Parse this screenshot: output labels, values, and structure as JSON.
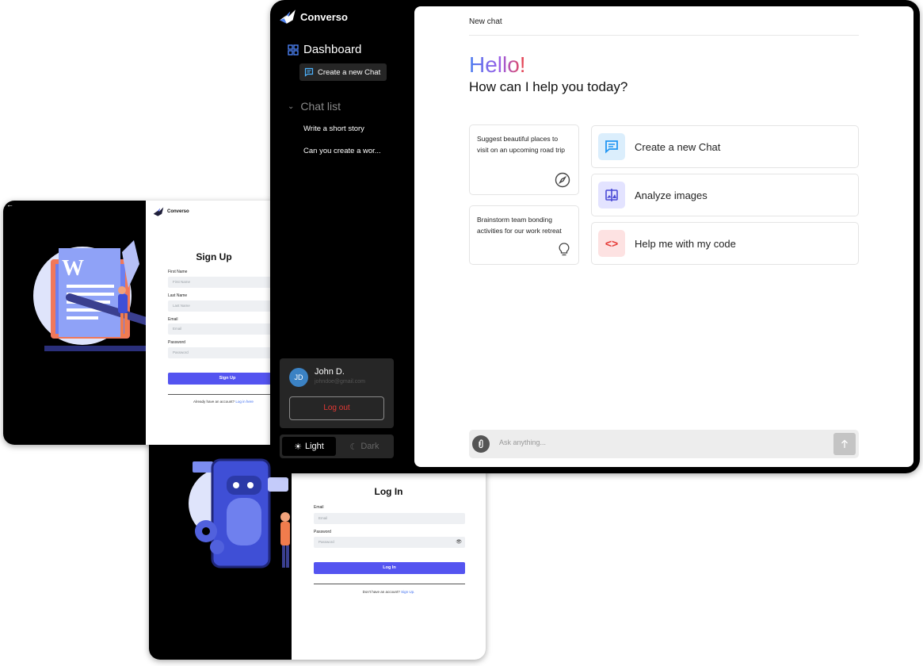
{
  "brand": "Converso",
  "sidebar": {
    "dashboard_label": "Dashboard",
    "new_chat_label": "Create a new Chat",
    "chat_list_label": "Chat list",
    "chats": [
      "Write a short story",
      "Can you create a wor..."
    ]
  },
  "user": {
    "initials": "JD",
    "name": "John D.",
    "email": "johndoe@gmail.com",
    "logout_label": "Log out"
  },
  "theme": {
    "light_label": "Light",
    "dark_label": "Dark",
    "selected": "Light"
  },
  "main": {
    "title": "New chat",
    "greeting": "Hello!",
    "prompt": "How can I help you today?",
    "suggestions": [
      "Suggest beautiful places to visit on an upcoming road trip",
      "Brainstorm team bonding activities for our work retreat"
    ],
    "actions": [
      "Create a new Chat",
      "Analyze images",
      "Help me with my code"
    ],
    "input_placeholder": "Ask anything..."
  },
  "signup": {
    "title": "Sign Up",
    "first_name_label": "First Name",
    "first_name_placeholder": "First Name",
    "last_name_label": "Last Name",
    "last_name_placeholder": "Last Name",
    "email_label": "Email",
    "email_placeholder": "Email",
    "password_label": "Password",
    "password_placeholder": "Password",
    "button": "Sign Up",
    "footer_text": "Already have an account?",
    "footer_link": "Log in here"
  },
  "login": {
    "title": "Log In",
    "email_label": "Email",
    "email_placeholder": "Email",
    "password_label": "Password",
    "password_placeholder": "Password",
    "button": "Log In",
    "footer_text": "Don't have an account?",
    "footer_link": "Sign Up."
  },
  "colors": {
    "accent": "#5454f0",
    "logout": "#e53935",
    "avatar": "#3b82c4",
    "chat_icon_bg": "#dbeefc",
    "image_icon_bg": "#e3e3ff",
    "code_icon_bg": "#fde2e2"
  },
  "icons": [
    "converso-logo-icon",
    "dashboard-grid-icon",
    "chat-bubble-icon",
    "chevron-down-icon",
    "compass-icon",
    "lightbulb-icon",
    "image-icon",
    "code-icon",
    "paperclip-icon",
    "arrow-up-icon",
    "sun-icon",
    "moon-icon",
    "eye-icon"
  ]
}
